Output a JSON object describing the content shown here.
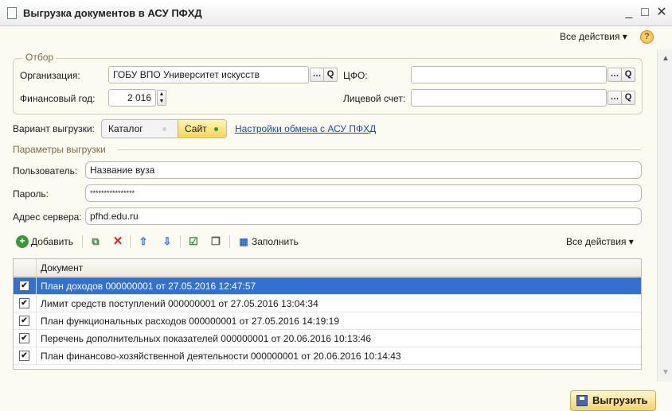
{
  "window": {
    "title": "Выгрузка документов в АСУ ПФХД",
    "minimize": "_",
    "maximize": "□",
    "close": "✕"
  },
  "top_actions": {
    "label": "Все действия ▾",
    "help": "?"
  },
  "filter": {
    "legend": "Отбор",
    "org_label": "Организация:",
    "org_value": "ГОБУ ВПО Университет искусств",
    "cfo_label": "ЦФО:",
    "cfo_value": "",
    "year_label": "Финансовый год:",
    "year_value": "2 016",
    "account_label": "Лицевой счет:",
    "account_value": ""
  },
  "export_variant": {
    "label": "Вариант выгрузки:",
    "options": [
      "Каталог",
      "Сайт"
    ],
    "selected": "Сайт",
    "settings_link": "Настройки обмена с АСУ ПФХД"
  },
  "params": {
    "legend": "Параметры выгрузки",
    "user_label": "Пользователь:",
    "user_value": "Название вуза",
    "password_label": "Пароль:",
    "password_value": "****************",
    "server_label": "Адрес сервера:",
    "server_value": "pfhd.edu.ru"
  },
  "toolbar": {
    "add_label": "Добавить",
    "fill_label": "Заполнить",
    "all_actions": "Все действия ▾"
  },
  "table": {
    "column_header": "Документ",
    "rows": [
      {
        "checked": true,
        "text": "План доходов 000000001 от 27.05.2016 12:47:57",
        "selected": true
      },
      {
        "checked": true,
        "text": "Лимит средств поступлений 000000001 от 27.05.2016 13:04:34",
        "selected": false
      },
      {
        "checked": true,
        "text": "План функциональных расходов 000000001 от 27.05.2016 14:19:19",
        "selected": false
      },
      {
        "checked": true,
        "text": "Перечень дополнительных показателей 000000001 от 20.06.2016 10:13:46",
        "selected": false
      },
      {
        "checked": true,
        "text": "План финансово-хозяйственной деятельности 000000001 от 20.06.2016 10:14:43",
        "selected": false
      }
    ]
  },
  "export_button": {
    "label": "Выгрузить"
  },
  "colors": {
    "accent": "#3370d4",
    "link": "#1a48b0",
    "button": "#f4d46a"
  }
}
